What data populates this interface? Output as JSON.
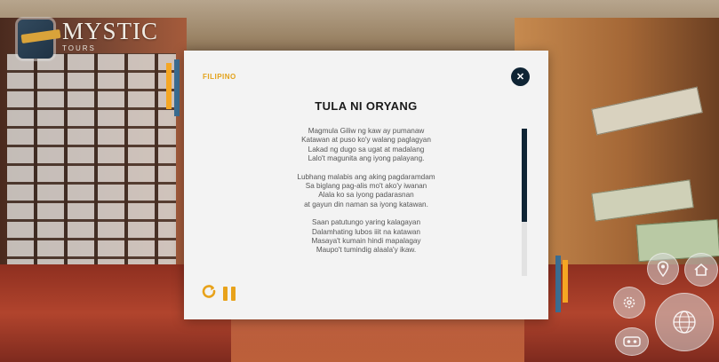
{
  "brand": {
    "name": "MYSTIC",
    "tagline": "TOURS"
  },
  "modal": {
    "language": "FILIPINO",
    "title": "TULA NI ORYANG",
    "stanzas": [
      [
        "Magmula Giliw ng kaw ay pumanaw",
        "Katawan at puso ko'y walang paglagyan",
        "Lakad ng dugo sa ugat at madalang",
        "Lalo't magunita ang iyong palayang."
      ],
      [
        "Lubhang malabis ang aking pagdaramdam",
        "Sa biglang pag-alis mo't ako'y iwanan",
        "Alala ko sa iyong padarasnan",
        "at gayun din naman sa iyong katawan."
      ],
      [
        "Saan patutungo yaring kalagayan",
        "Dalamhating lubos iiit na katawan",
        "Masaya't kumain hindi mapalagay",
        "Maupo't tumindig alaala'y ikaw."
      ]
    ],
    "scroll_fraction": 0.63
  },
  "icons": {
    "close": "close-icon",
    "replay": "replay-icon",
    "pause": "pause-icon",
    "location": "location-pin-icon",
    "home": "home-icon",
    "settings": "settings-icon",
    "globe": "globe-icon",
    "vr": "vr-headset-icon"
  },
  "colors": {
    "accent": "#f5a623",
    "dark": "#0f2434",
    "blue_accent": "#3b6e93",
    "modal_bg": "#f3f3f3"
  }
}
